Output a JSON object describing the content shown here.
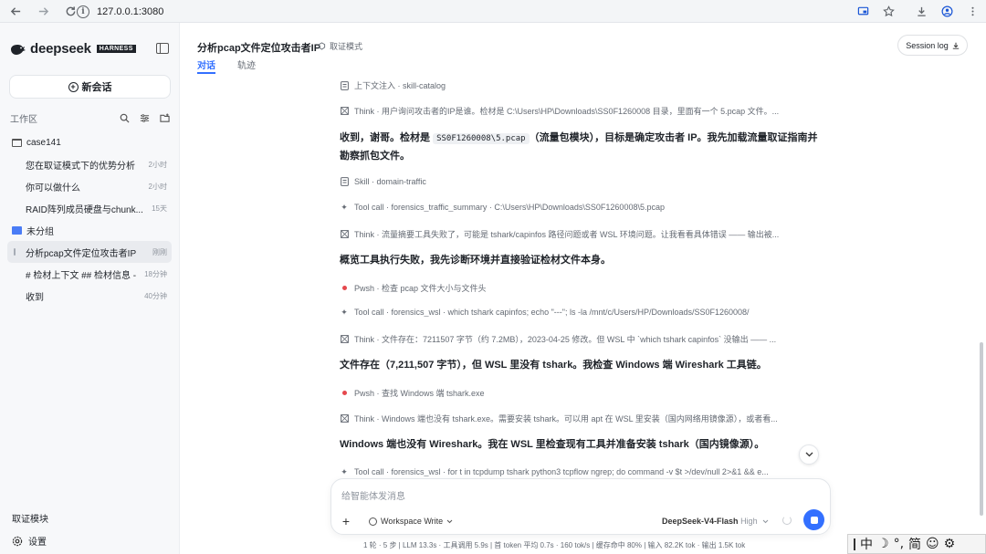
{
  "browser": {
    "url": "127.0.0.1:3080",
    "info_icon": "info-icon"
  },
  "sidebar": {
    "brand": "deepseek",
    "brand_tag": "HARNESS",
    "new_chat_label": "新会话",
    "workspace_label": "工作区",
    "folders": [
      {
        "name": "case141",
        "items": [
          {
            "title": "您在取证模式下的优势分析",
            "time": "2小时"
          },
          {
            "title": "你可以做什么",
            "time": "2小时"
          },
          {
            "title": "RAID阵列成员硬盘与chunk...",
            "time": "15天"
          }
        ]
      },
      {
        "name": "未分组",
        "items": [
          {
            "title": "分析pcap文件定位攻击者IP",
            "time": "刚刚",
            "active": true
          },
          {
            "title": "# 检材上下文 ## 检材信息 -",
            "time": "18分钟"
          },
          {
            "title": "收到",
            "time": "40分钟"
          }
        ]
      }
    ],
    "forensic_module_label": "取证模块",
    "settings_label": "设置"
  },
  "header": {
    "title": "分析pcap文件定位攻击者IP",
    "mode": "取证模式",
    "tabs": [
      {
        "label": "对话",
        "active": true
      },
      {
        "label": "轨迹",
        "active": false
      }
    ],
    "session_log_label": "Session log"
  },
  "messages": {
    "r1": {
      "kind": "上下文注入",
      "detail": "skill-catalog"
    },
    "r2": {
      "kind": "Think",
      "detail": "用户询问攻击者的IP是谁。检材是 C:\\Users\\HP\\Downloads\\SS0F1260008 目录，里面有一个 5.pcap 文件。..."
    },
    "p1_a": "收到，谢哥。检材是",
    "p1_code": "SS0F1260008\\5.pcap",
    "p1_b": "（流量包模块），目标是确定攻击者 IP。我先加载流量取证指南并勘察抓包文件。",
    "r3": {
      "kind": "Skill",
      "detail": "domain-traffic"
    },
    "r4": {
      "kind": "Tool call",
      "detail": "forensics_traffic_summary · C:\\Users\\HP\\Downloads\\SS0F1260008\\5.pcap"
    },
    "r5": {
      "kind": "Think",
      "detail": "流量摘要工具失败了，可能是 tshark/capinfos 路径问题或者 WSL 环境问题。让我看看具体错误 —— 输出被..."
    },
    "p2": "概览工具执行失败，我先诊断环境并直接验证检材文件本身。",
    "r6": {
      "kind": "Pwsh",
      "detail": "检查 pcap 文件大小与文件头"
    },
    "r7": {
      "kind": "Tool call",
      "detail": "forensics_wsl · which tshark capinfos; echo \"---\"; ls -la /mnt/c/Users/HP/Downloads/SS0F1260008/"
    },
    "r8": {
      "kind": "Think",
      "detail": "文件存在：7211507 字节（约 7.2MB），2023-04-25 修改。但 WSL 中 `which tshark capinfos` 没输出 —— ..."
    },
    "p3": "文件存在（7,211,507 字节），但 WSL 里没有 tshark。我检查 Windows 端 Wireshark 工具链。",
    "r9": {
      "kind": "Pwsh",
      "detail": "查找 Windows 端 tshark.exe"
    },
    "r10": {
      "kind": "Think",
      "detail": "Windows 端也没有 tshark.exe。需要安装 tshark。可以用 apt 在 WSL 里安装（国内网络用镜像源），或者看..."
    },
    "p4": "Windows 端也没有 Wireshark。我在 WSL 里检查现有工具并准备安装 tshark（国内镜像源）。",
    "r11": {
      "kind": "Tool call",
      "detail": "forensics_wsl · for t in tcpdump tshark python3 tcpflow ngrep; do command -v $t >/dev/null 2>&1 && e..."
    }
  },
  "composer": {
    "placeholder": "给智能体发消息",
    "permission": "Workspace Write",
    "model": "DeepSeek-V4-Flash",
    "level": "High"
  },
  "statusbar": "1 轮 · 5 步  |  LLM 13.3s · 工具调用 5.9s  |  首 token 平均 0.7s · 160 tok/s  |  缓存命中 80%  |  输入 82.2K tok · 输出 1.5K tok",
  "ime": {
    "mode": "中",
    "moon": "☽",
    "punct": "°,",
    "script": "简",
    "emoji": "☺",
    "gear": "⚙"
  },
  "colors": {
    "accent": "#3370ff",
    "active_item_bg": "#e9ebef",
    "pwsh_dot": "#e5484d"
  }
}
